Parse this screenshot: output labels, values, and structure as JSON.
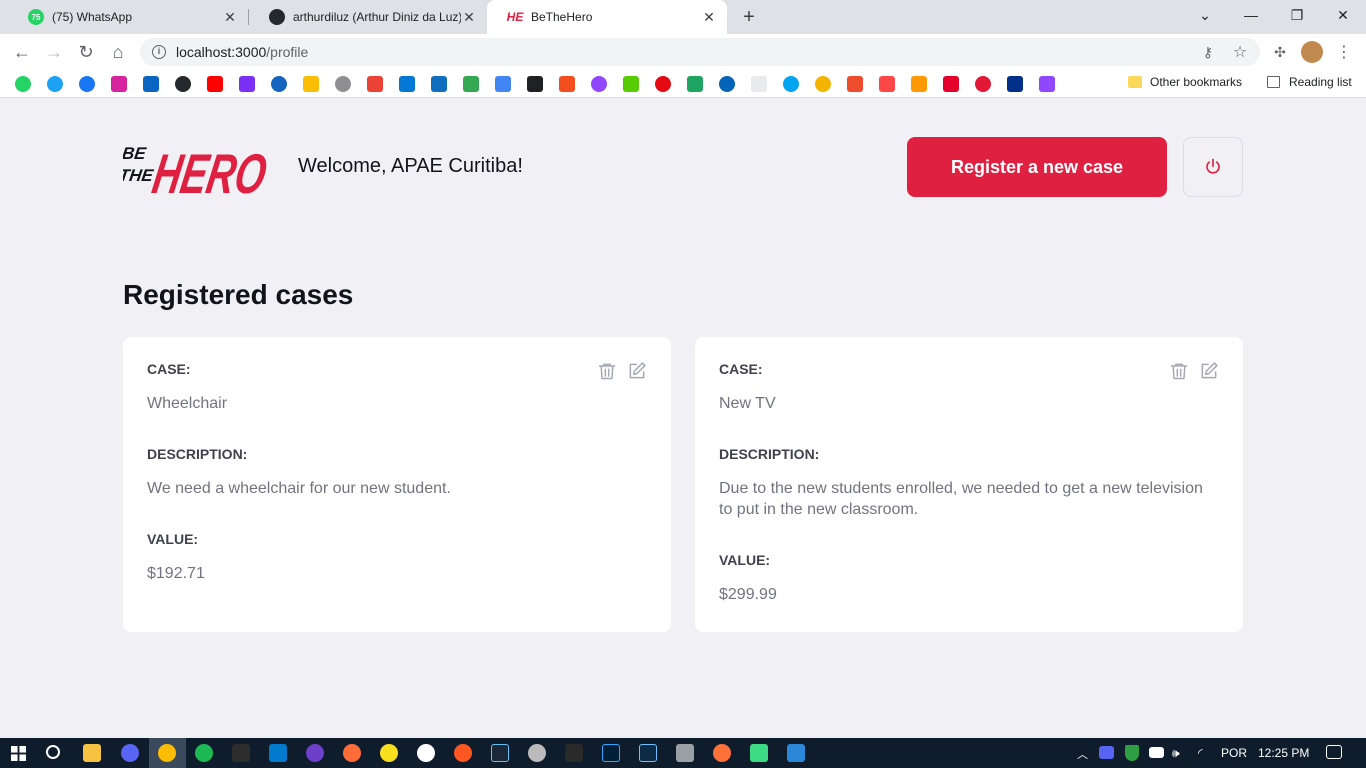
{
  "browser": {
    "tabs": [
      {
        "title": "(75) WhatsApp",
        "badge": "75"
      },
      {
        "title": "arthurdiluz (Arthur Diniz da Luz)"
      },
      {
        "title": "BeTheHero"
      }
    ],
    "url_host": "localhost:3000",
    "url_path": "/profile",
    "other_bookmarks": "Other bookmarks",
    "reading_list": "Reading list"
  },
  "header": {
    "welcome": "Welcome, APAE Curitiba!",
    "register_label": "Register a new case",
    "logo_text_small": "BE THE",
    "logo_text_big": "HERO"
  },
  "main": {
    "title": "Registered cases",
    "cases": [
      {
        "case_label": "CASE:",
        "case_value": "Wheelchair",
        "description_label": "DESCRIPTION:",
        "description_value": "We need a wheelchair for our new student.",
        "value_label": "VALUE:",
        "value_value": "$192.71"
      },
      {
        "case_label": "CASE:",
        "case_value": "New TV",
        "description_label": "DESCRIPTION:",
        "description_value": "Due to the new students enrolled, we needed to get a new television to put in the new classroom.",
        "value_label": "VALUE:",
        "value_value": "$299.99"
      }
    ]
  },
  "taskbar": {
    "language": "POR",
    "time": "12:25 PM"
  },
  "colors": {
    "brand": "#e02041",
    "background": "#f0f0f5"
  }
}
